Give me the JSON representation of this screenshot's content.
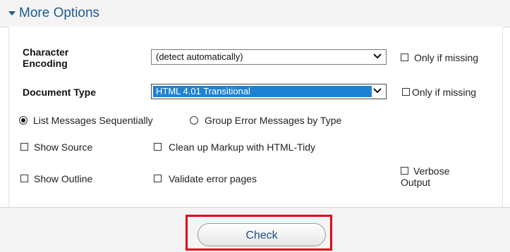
{
  "header": {
    "title": "More Options"
  },
  "encoding": {
    "label_line1": "Character",
    "label_line2": "Encoding",
    "selected": "(detect automatically)",
    "only_if_missing": "Only if missing"
  },
  "doctype": {
    "label": "Document Type",
    "selected": "HTML 4.01 Transitional",
    "only_if_missing": "Only if missing"
  },
  "group_options": {
    "list_sequentially": "List Messages Sequentially",
    "group_by_type": "Group Error Messages by Type",
    "selected": "List Messages Sequentially"
  },
  "options": {
    "show_source": "Show Source",
    "clean_up": "Clean up Markup with HTML-Tidy",
    "show_outline": "Show Outline",
    "validate_error_pages": "Validate error pages",
    "verbose_line1": "Verbose",
    "verbose_line2": "Output"
  },
  "submit": {
    "label": "Check"
  },
  "colors": {
    "accent": "#1b5a92",
    "highlight": "#1e82d2",
    "focus_frame": "#e0001b"
  }
}
